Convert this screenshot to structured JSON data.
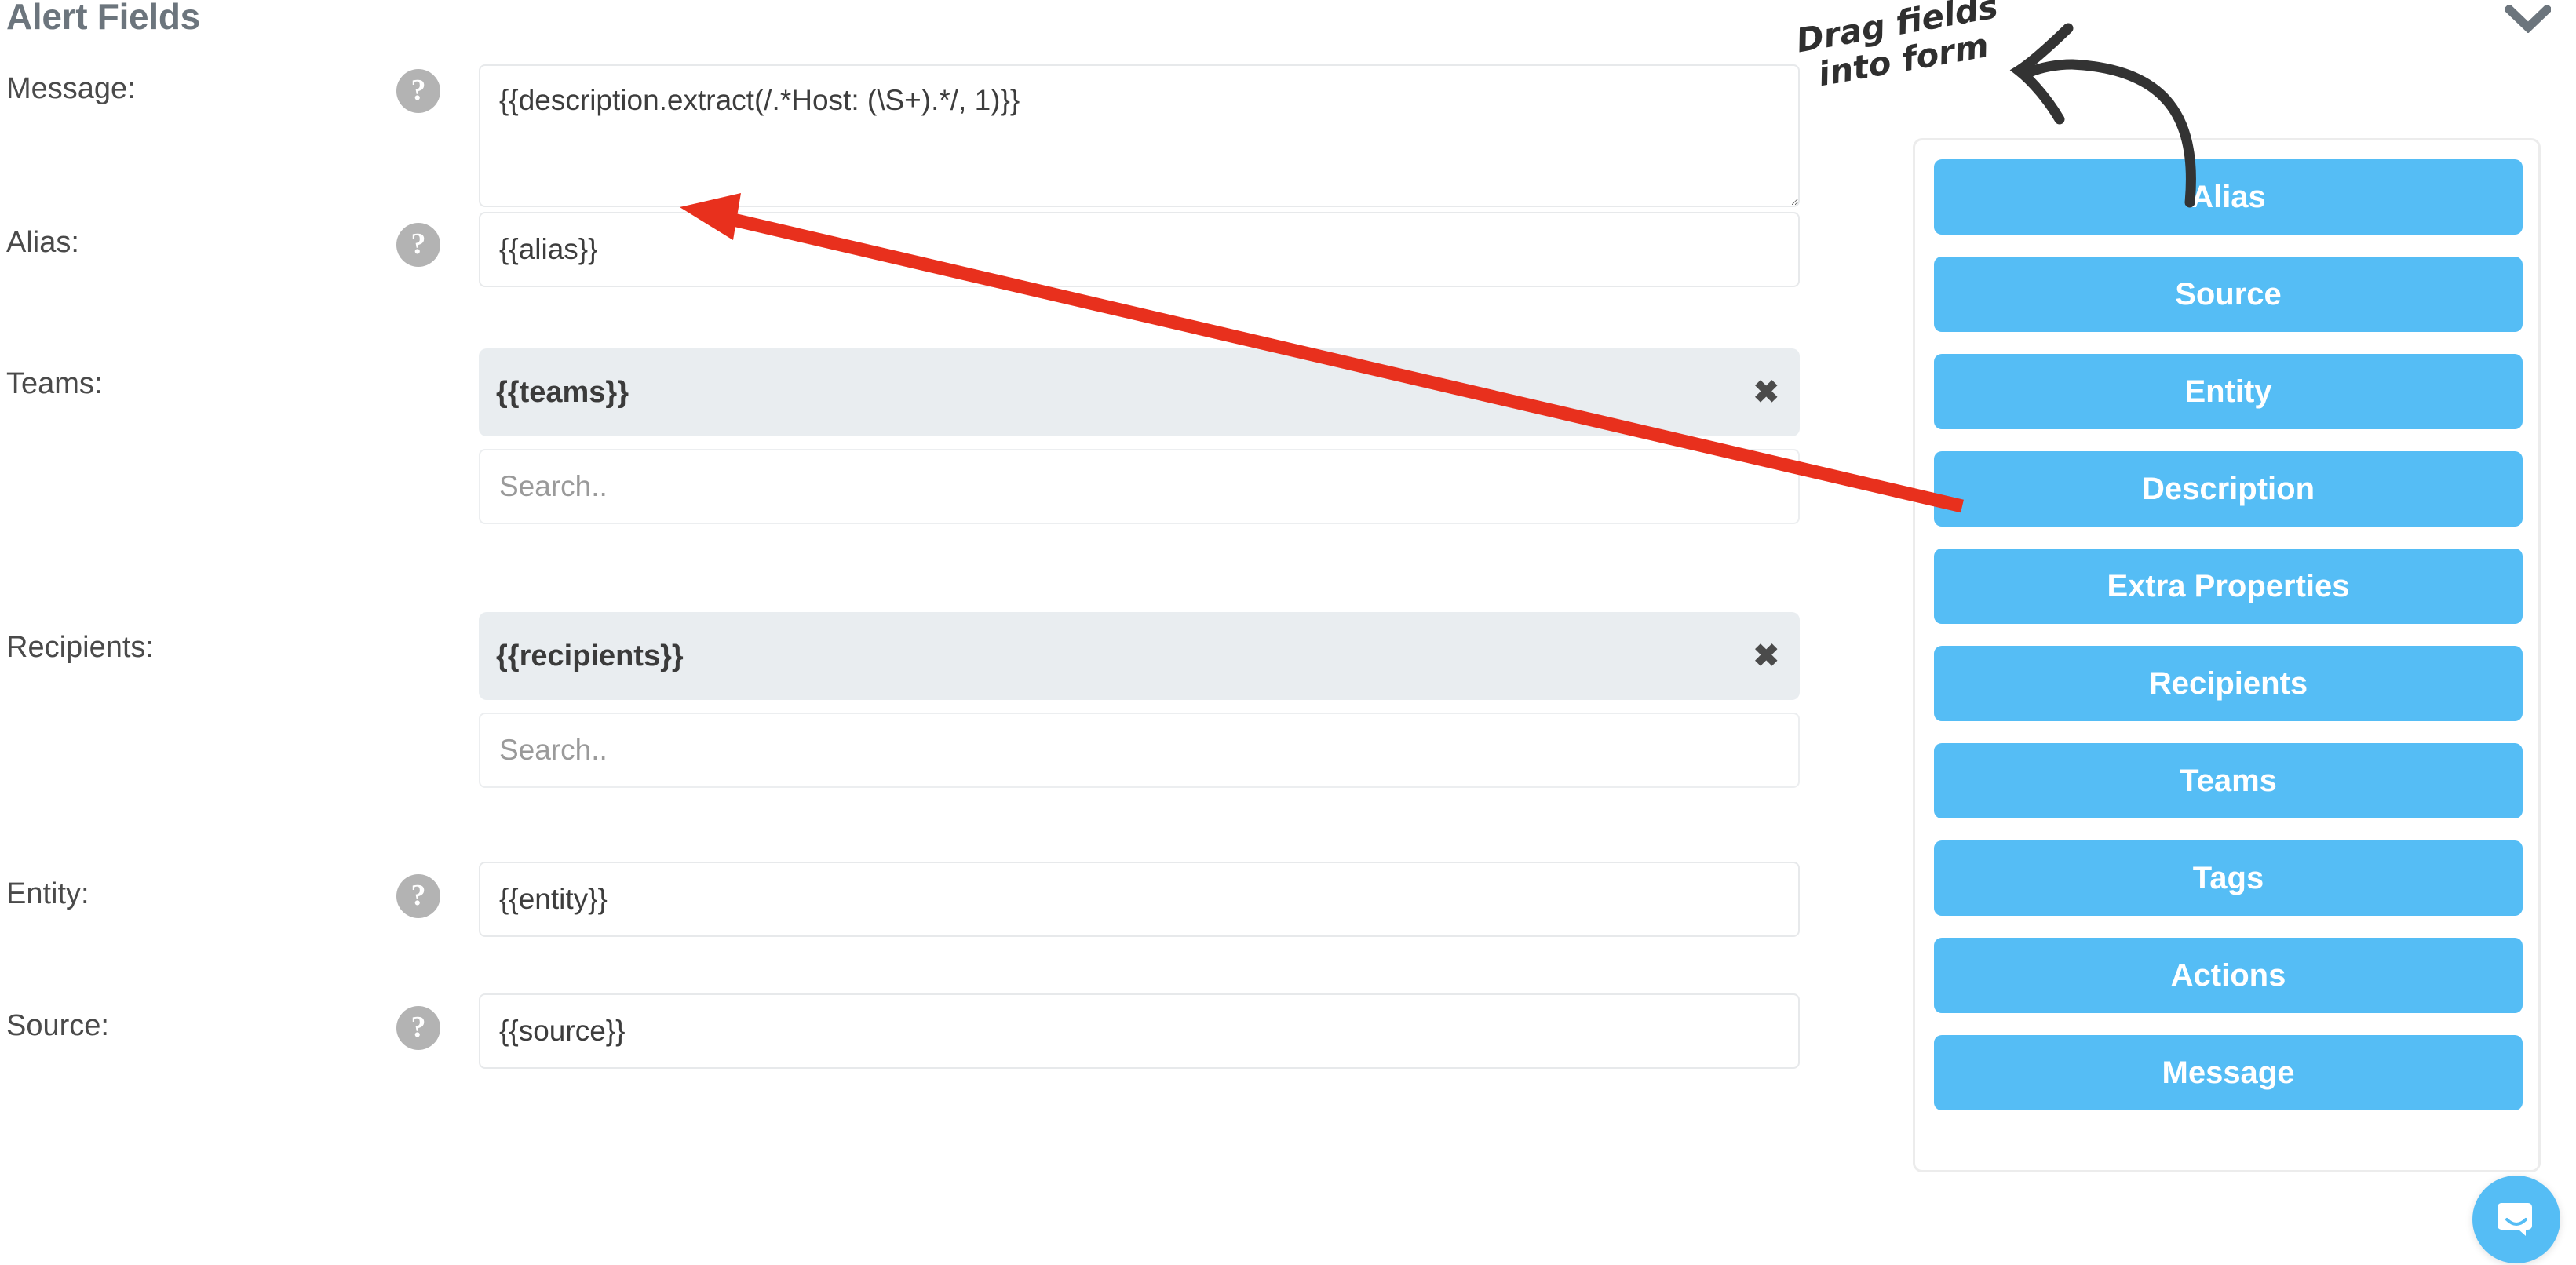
{
  "header": {
    "title": "Alert Fields",
    "collapse_icon": "chevron-down-icon"
  },
  "form": {
    "rows": [
      {
        "key": "message",
        "label": "Message:",
        "help_icon": "question-mark-icon",
        "value": "{{description.extract(/.*Host: (\\S+).*/, 1)}}",
        "type": "textarea"
      },
      {
        "key": "alias",
        "label": "Alias:",
        "help_icon": "question-mark-icon",
        "value": "{{alias}}",
        "type": "text"
      },
      {
        "key": "teams",
        "label": "Teams:",
        "token": "{{teams}}",
        "remove_icon": "close-icon",
        "search_placeholder": "Search..",
        "search_value": "",
        "type": "token"
      },
      {
        "key": "recipients",
        "label": "Recipients:",
        "token": "{{recipients}}",
        "remove_icon": "close-icon",
        "search_placeholder": "Search..",
        "search_value": "",
        "type": "token"
      },
      {
        "key": "entity",
        "label": "Entity:",
        "help_icon": "question-mark-icon",
        "value": "{{entity}}",
        "type": "text"
      },
      {
        "key": "source",
        "label": "Source:",
        "help_icon": "question-mark-icon",
        "value": "{{source}}",
        "type": "text"
      }
    ]
  },
  "palette": {
    "buttons": [
      {
        "label": "Alias"
      },
      {
        "label": "Source"
      },
      {
        "label": "Entity"
      },
      {
        "label": "Description"
      },
      {
        "label": "Extra Properties"
      },
      {
        "label": "Recipients"
      },
      {
        "label": "Teams"
      },
      {
        "label": "Tags"
      },
      {
        "label": "Actions"
      },
      {
        "label": "Message"
      }
    ]
  },
  "annotations": {
    "note_line1": "Drag fields",
    "note_line2": "into form",
    "black_arrow_icon": "curved-arrow-left-icon",
    "red_arrow_icon": "straight-arrow-icon"
  },
  "chat": {
    "launcher_icon": "chat-bubble-icon"
  },
  "colors": {
    "accent_blue": "#55bdf5",
    "title_gray": "#6c757d",
    "annotation_red": "#e8301d",
    "annotation_black": "#333333",
    "chip_bg": "#e9edf0"
  }
}
